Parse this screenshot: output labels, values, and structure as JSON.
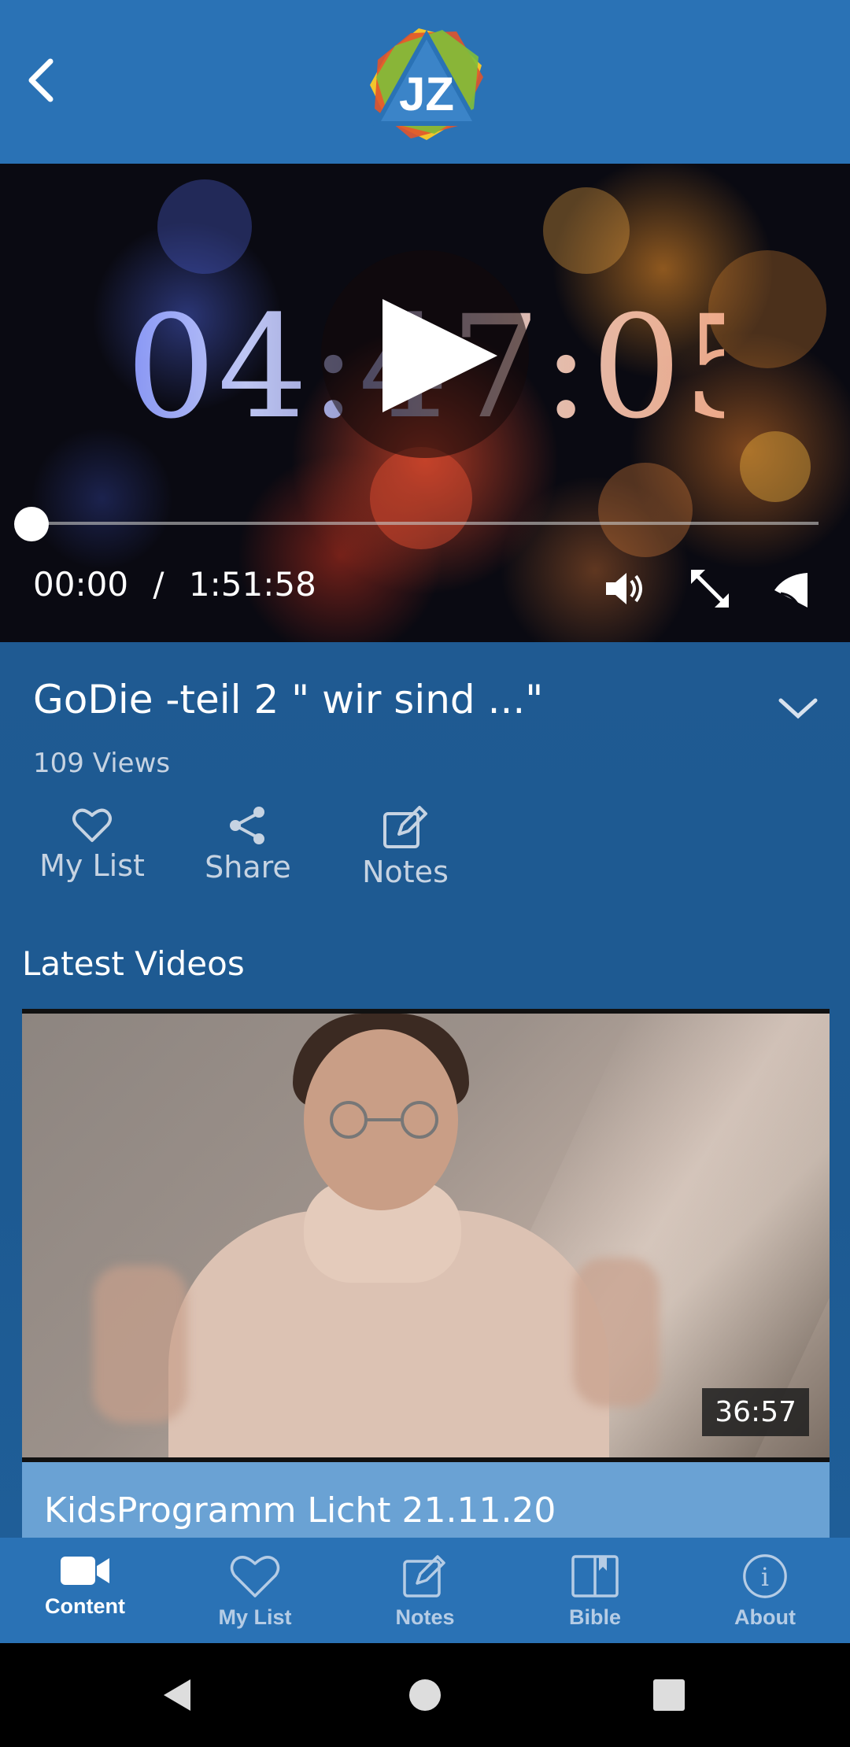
{
  "header": {
    "logo_text": "JZ",
    "back_icon": "chevron-left-icon"
  },
  "video": {
    "countdown_text": "04:47:05",
    "current_time": "00:00",
    "separator": "/",
    "duration": "1:51:58",
    "progress": 0.0,
    "controls": [
      "volume-icon",
      "fullscreen-icon",
      "cast-icon"
    ]
  },
  "info": {
    "title": "GoDie -teil 2 \" wir sind ...\"",
    "views": "109 Views",
    "actions": [
      {
        "label": "My List",
        "icon": "heart-icon"
      },
      {
        "label": "Share",
        "icon": "share-icon"
      },
      {
        "label": "Notes",
        "icon": "edit-icon"
      }
    ]
  },
  "latest": {
    "section_title": "Latest Videos",
    "cards": [
      {
        "title": "KidsProgramm Licht 21.11.20",
        "duration": "36:57"
      }
    ]
  },
  "bottom_nav": [
    {
      "label": "Content",
      "icon": "video-camera-icon",
      "active": true
    },
    {
      "label": "My List",
      "icon": "heart-icon",
      "active": false
    },
    {
      "label": "Notes",
      "icon": "edit-icon",
      "active": false
    },
    {
      "label": "Bible",
      "icon": "book-icon",
      "active": false
    },
    {
      "label": "About",
      "icon": "info-icon",
      "active": false
    }
  ],
  "colors": {
    "header": "#2a72b5",
    "info_bg": "#1f5a92",
    "card_title_bg": "#6aa2d4",
    "nav_inactive": "#b5cce5"
  }
}
